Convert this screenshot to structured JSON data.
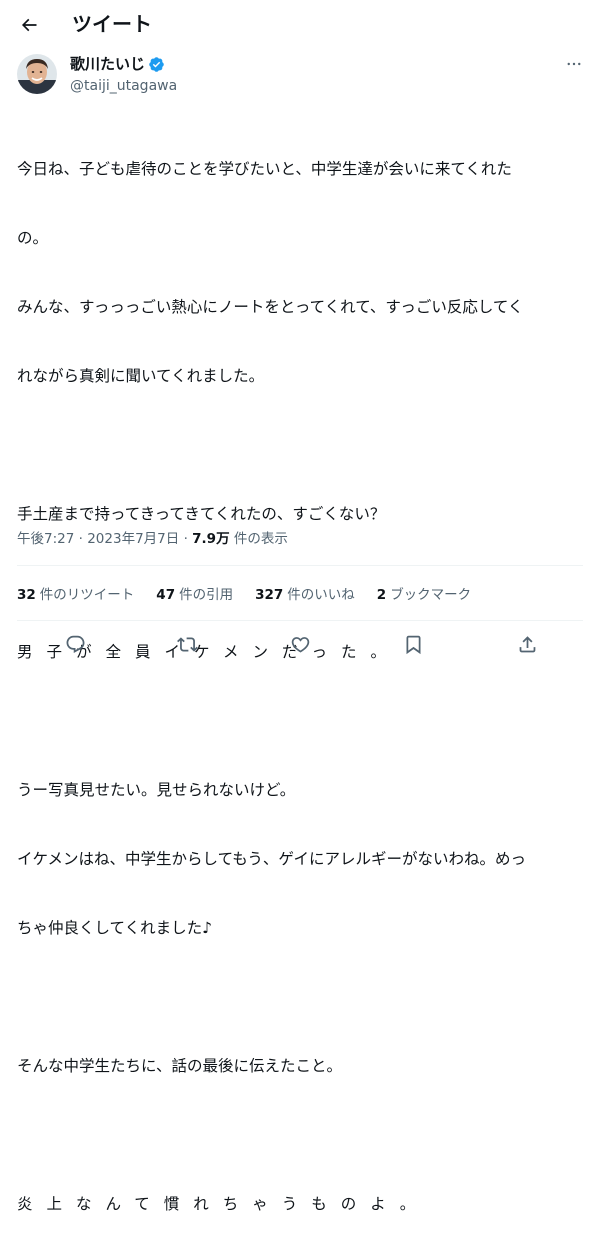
{
  "header": {
    "title": "ツイート"
  },
  "author": {
    "display_name": "歌川たいじ",
    "handle": "@taiji_utagawa",
    "verified_color": "#1d9bf0"
  },
  "tweet": {
    "lines": [
      "今日ね、子ども虐待のことを学びたいと、中学生達が会いに来てくれた",
      "の。",
      "みんな、すっっっごい熱心にノートをとってくれて、すっごい反応してく",
      "れながら真剣に聞いてくれました。",
      "",
      "手土産まで持ってきってきてくれたの、すごくない？",
      "",
      "男子が全員イケメンだった。",
      "",
      "うー写真見せたい。見せられないけど。",
      "イケメンはね、中学生からしてもう、ゲイにアレルギーがないわね。めっ",
      "ちゃ仲良くしてくれました♪",
      "",
      "そんな中学生たちに、話の最後に伝えたこと。",
      "",
      "炎上なんて慣れちゃうものよ。"
    ]
  },
  "meta": {
    "time": "午後7:27",
    "separator": "·",
    "date": "2023年7月7日",
    "views_count": "7.9万",
    "views_label": "件の表示"
  },
  "stats": {
    "retweets_count": "32",
    "retweets_label": "件のリツイート",
    "quotes_count": "47",
    "quotes_label": "件の引用",
    "likes_count": "327",
    "likes_label": "件のいいね",
    "bookmarks_count": "2",
    "bookmarks_label": "ブックマーク"
  },
  "icons": {
    "back": "arrow-left-icon",
    "more": "more-horizontal-icon",
    "reply": "reply-icon",
    "retweet": "retweet-icon",
    "like": "heart-icon",
    "bookmark": "bookmark-icon",
    "share": "share-icon",
    "verified": "verified-badge-icon"
  }
}
